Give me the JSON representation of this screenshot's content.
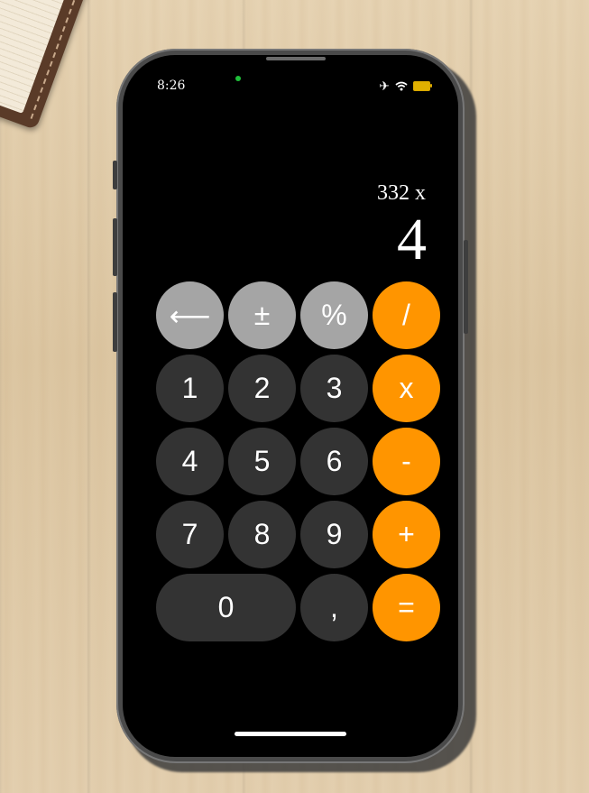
{
  "status_bar": {
    "time": "8:26",
    "airplane_icon": "✈",
    "wifi_icon": "wifi-icon",
    "battery_color": "#e0b000"
  },
  "display": {
    "expression": "332 x",
    "result": "4"
  },
  "colors": {
    "function_key": "#a5a5a5",
    "number_key": "#333333",
    "operator_key": "#ff9500",
    "camera_dot": "#1fbf3a"
  },
  "keys": {
    "backspace": "⟵",
    "plus_minus": "±",
    "percent": "%",
    "divide": "/",
    "one": "1",
    "two": "2",
    "three": "3",
    "multiply": "x",
    "four": "4",
    "five": "5",
    "six": "6",
    "minus": "-",
    "seven": "7",
    "eight": "8",
    "nine": "9",
    "plus": "+",
    "zero": "0",
    "decimal": ",",
    "equals": "="
  }
}
